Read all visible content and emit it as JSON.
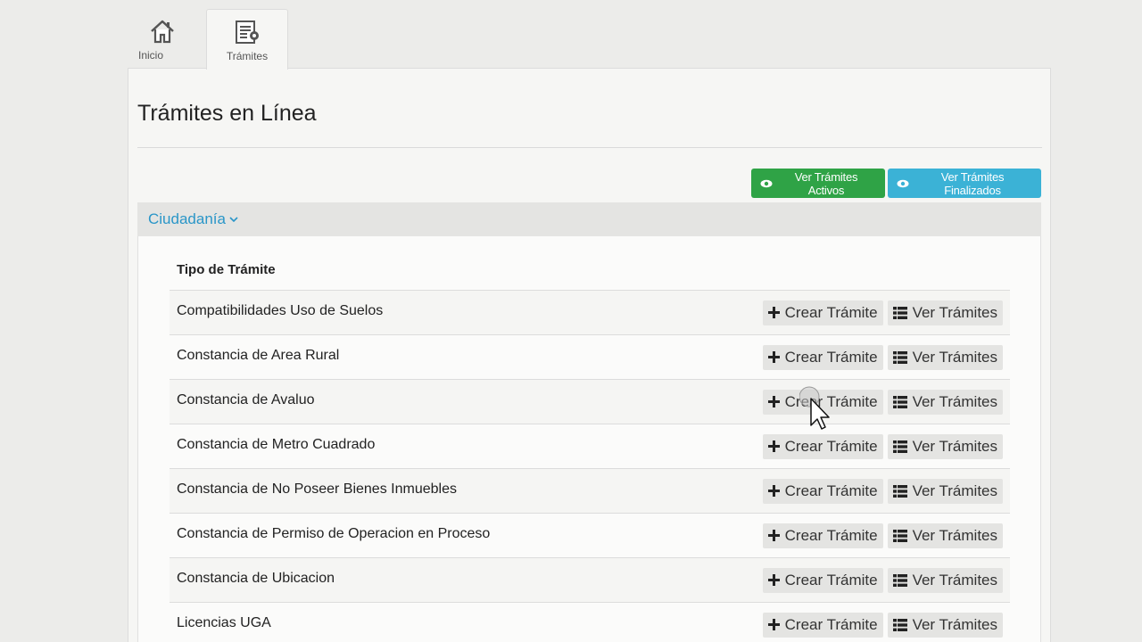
{
  "tabs": [
    {
      "label": "Inicio",
      "icon": "home-icon"
    },
    {
      "label": "Trámites",
      "icon": "document-icon"
    }
  ],
  "page": {
    "title": "Trámites en Línea"
  },
  "buttons": {
    "activos": "Ver Trámites Activos",
    "finalizados": "Ver Trámites Finalizados"
  },
  "section": {
    "title": "Ciudadanía"
  },
  "table": {
    "header": "Tipo de Trámite",
    "crear_label": "Crear Trámite",
    "ver_label": "Ver Trámites",
    "rows": [
      "Compatibilidades Uso de Suelos",
      "Constancia de Area Rural",
      "Constancia de Avaluo",
      "Constancia de Metro Cuadrado",
      "Constancia de No Poseer Bienes Inmuebles",
      "Constancia de Permiso de Operacion en Proceso",
      "Constancia de Ubicacion",
      "Licencias UGA"
    ]
  },
  "colors": {
    "green": "#2fa346",
    "blue": "#3bb2d6",
    "link": "#2a96c8"
  }
}
